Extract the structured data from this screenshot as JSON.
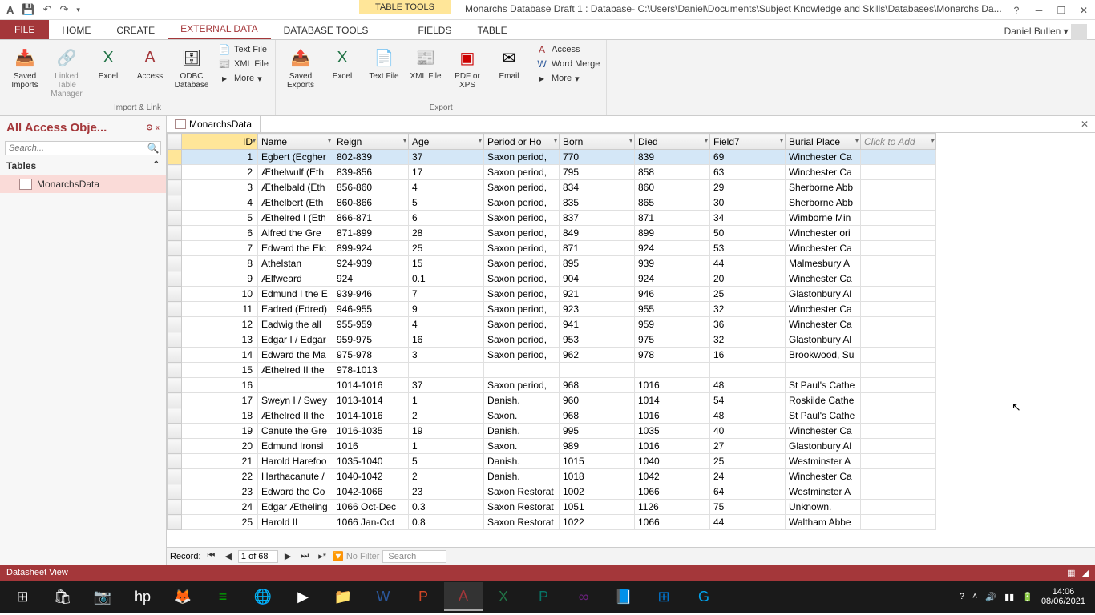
{
  "titlebar": {
    "tools_label": "TABLE TOOLS",
    "title": "Monarchs Database Draft 1 : Database- C:\\Users\\Daniel\\Documents\\Subject Knowledge and Skills\\Databases\\Monarchs Da..."
  },
  "user": "Daniel Bullen",
  "tabs": {
    "file": "FILE",
    "home": "HOME",
    "create": "CREATE",
    "external": "EXTERNAL DATA",
    "dbtools": "DATABASE TOOLS",
    "fields": "FIELDS",
    "table": "TABLE"
  },
  "ribbon": {
    "saved_imports": "Saved\nImports",
    "linked_table": "Linked Table\nManager",
    "excel": "Excel",
    "access": "Access",
    "odbc": "ODBC\nDatabase",
    "text_file": "Text File",
    "xml_file": "XML File",
    "more": "More",
    "saved_exports": "Saved\nExports",
    "excel2": "Excel",
    "text2": "Text\nFile",
    "xml2": "XML\nFile",
    "pdf": "PDF\nor XPS",
    "email": "Email",
    "access2": "Access",
    "word_merge": "Word Merge",
    "more2": "More",
    "group_import": "Import & Link",
    "group_export": "Export"
  },
  "nav": {
    "header": "All Access Obje...",
    "search_ph": "Search...",
    "section": "Tables",
    "item": "MonarchsData"
  },
  "doc_tab": "MonarchsData",
  "columns": [
    "ID",
    "Name",
    "Reign",
    "Age",
    "Period or Ho",
    "Born",
    "Died",
    "Field7",
    "Burial Place",
    "Click to Add"
  ],
  "rows": [
    {
      "id": 1,
      "name": "Egbert (Ecgher",
      "reign": "802-839",
      "age": "37",
      "period": "Saxon period,",
      "born": "770",
      "died": "839",
      "f7": "69",
      "burial": "Winchester Ca"
    },
    {
      "id": 2,
      "name": "Æthelwulf (Eth",
      "reign": "839-856",
      "age": "17",
      "period": "Saxon period,",
      "born": "795",
      "died": "858",
      "f7": "63",
      "burial": "Winchester Ca"
    },
    {
      "id": 3,
      "name": "Æthelbald (Eth",
      "reign": "856-860",
      "age": "4",
      "period": "Saxon period,",
      "born": "834",
      "died": "860",
      "f7": "29",
      "burial": "Sherborne Abb"
    },
    {
      "id": 4,
      "name": "Æthelbert (Eth",
      "reign": "860-866",
      "age": "5",
      "period": "Saxon period,",
      "born": "835",
      "died": "865",
      "f7": "30",
      "burial": "Sherborne Abb"
    },
    {
      "id": 5,
      "name": "Æthelred I (Eth",
      "reign": "866-871",
      "age": "6",
      "period": "Saxon period,",
      "born": "837",
      "died": "871",
      "f7": "34",
      "burial": "Wimborne Min"
    },
    {
      "id": 6,
      "name": "Alfred the Gre",
      "reign": "871-899",
      "age": "28",
      "period": "Saxon period,",
      "born": "849",
      "died": "899",
      "f7": "50",
      "burial": "Winchester ori"
    },
    {
      "id": 7,
      "name": "Edward the Elc",
      "reign": "899-924",
      "age": "25",
      "period": "Saxon period,",
      "born": "871",
      "died": "924",
      "f7": "53",
      "burial": "Winchester Ca"
    },
    {
      "id": 8,
      "name": "Athelstan",
      "reign": "924-939",
      "age": "15",
      "period": "Saxon period,",
      "born": "895",
      "died": "939",
      "f7": "44",
      "burial": "Malmesbury A"
    },
    {
      "id": 9,
      "name": "Ælfweard",
      "reign": "924",
      "age": "0.1",
      "period": "Saxon period,",
      "born": "904",
      "died": "924",
      "f7": "20",
      "burial": "Winchester Ca"
    },
    {
      "id": 10,
      "name": "Edmund I the E",
      "reign": "939-946",
      "age": "7",
      "period": "Saxon period,",
      "born": "921",
      "died": "946",
      "f7": "25",
      "burial": "Glastonbury Al"
    },
    {
      "id": 11,
      "name": "Eadred (Edred)",
      "reign": "946-955",
      "age": "9",
      "period": "Saxon period,",
      "born": "923",
      "died": "955",
      "f7": "32",
      "burial": "Winchester Ca"
    },
    {
      "id": 12,
      "name": "Eadwig the all",
      "reign": "955-959",
      "age": "4",
      "period": "Saxon period,",
      "born": "941",
      "died": "959",
      "f7": "36",
      "burial": "Winchester Ca"
    },
    {
      "id": 13,
      "name": "Edgar I / Edgar",
      "reign": "959-975",
      "age": "16",
      "period": "Saxon period,",
      "born": "953",
      "died": "975",
      "f7": "32",
      "burial": "Glastonbury Al"
    },
    {
      "id": 14,
      "name": "Edward the Ma",
      "reign": "975-978",
      "age": "3",
      "period": "Saxon period,",
      "born": "962",
      "died": "978",
      "f7": "16",
      "burial": "Brookwood, Su"
    },
    {
      "id": 15,
      "name": "Æthelred II the",
      "reign": "978-1013",
      "age": "",
      "period": "",
      "born": "",
      "died": "",
      "f7": "",
      "burial": ""
    },
    {
      "id": 16,
      "name": "",
      "reign": "1014-1016",
      "age": "37",
      "period": "Saxon period,",
      "born": "968",
      "died": "1016",
      "f7": "48",
      "burial": "St Paul's Cathe"
    },
    {
      "id": 17,
      "name": "Sweyn I / Swey",
      "reign": "1013-1014",
      "age": "1",
      "period": "Danish.",
      "born": "960",
      "died": "1014",
      "f7": "54",
      "burial": "Roskilde Cathe"
    },
    {
      "id": 18,
      "name": "Æthelred II the",
      "reign": "1014-1016",
      "age": "2",
      "period": "Saxon.",
      "born": "968",
      "died": "1016",
      "f7": "48",
      "burial": "St Paul's Cathe"
    },
    {
      "id": 19,
      "name": "Canute the Gre",
      "reign": "1016-1035",
      "age": "19",
      "period": "Danish.",
      "born": "995",
      "died": "1035",
      "f7": "40",
      "burial": "Winchester Ca"
    },
    {
      "id": 20,
      "name": "Edmund Ironsi",
      "reign": "1016",
      "age": "1",
      "period": "Saxon.",
      "born": "989",
      "died": "1016",
      "f7": "27",
      "burial": "Glastonbury Al"
    },
    {
      "id": 21,
      "name": "Harold Harefoo",
      "reign": "1035-1040",
      "age": "5",
      "period": "Danish.",
      "born": "1015",
      "died": "1040",
      "f7": "25",
      "burial": "Westminster A"
    },
    {
      "id": 22,
      "name": "Harthacanute /",
      "reign": "1040-1042",
      "age": "2",
      "period": "Danish.",
      "born": "1018",
      "died": "1042",
      "f7": "24",
      "burial": "Winchester Ca"
    },
    {
      "id": 23,
      "name": "Edward the Co",
      "reign": "1042-1066",
      "age": "23",
      "period": "Saxon Restorat",
      "born": "1002",
      "died": "1066",
      "f7": "64",
      "burial": "Westminster A"
    },
    {
      "id": 24,
      "name": "Edgar Ætheling",
      "reign": "1066 Oct-Dec",
      "age": "0.3",
      "period": "Saxon Restorat",
      "born": "1051",
      "died": "1126",
      "f7": "75",
      "burial": "Unknown."
    },
    {
      "id": 25,
      "name": "Harold II",
      "reign": "1066 Jan-Oct",
      "age": "0.8",
      "period": "Saxon Restorat",
      "born": "1022",
      "died": "1066",
      "f7": "44",
      "burial": "Waltham Abbe"
    }
  ],
  "recnav": {
    "label": "Record:",
    "pos": "1 of 68",
    "nofilter": "No Filter",
    "search": "Search"
  },
  "status": "Datasheet View",
  "clock": {
    "time": "14:06",
    "date": "08/06/2021"
  }
}
